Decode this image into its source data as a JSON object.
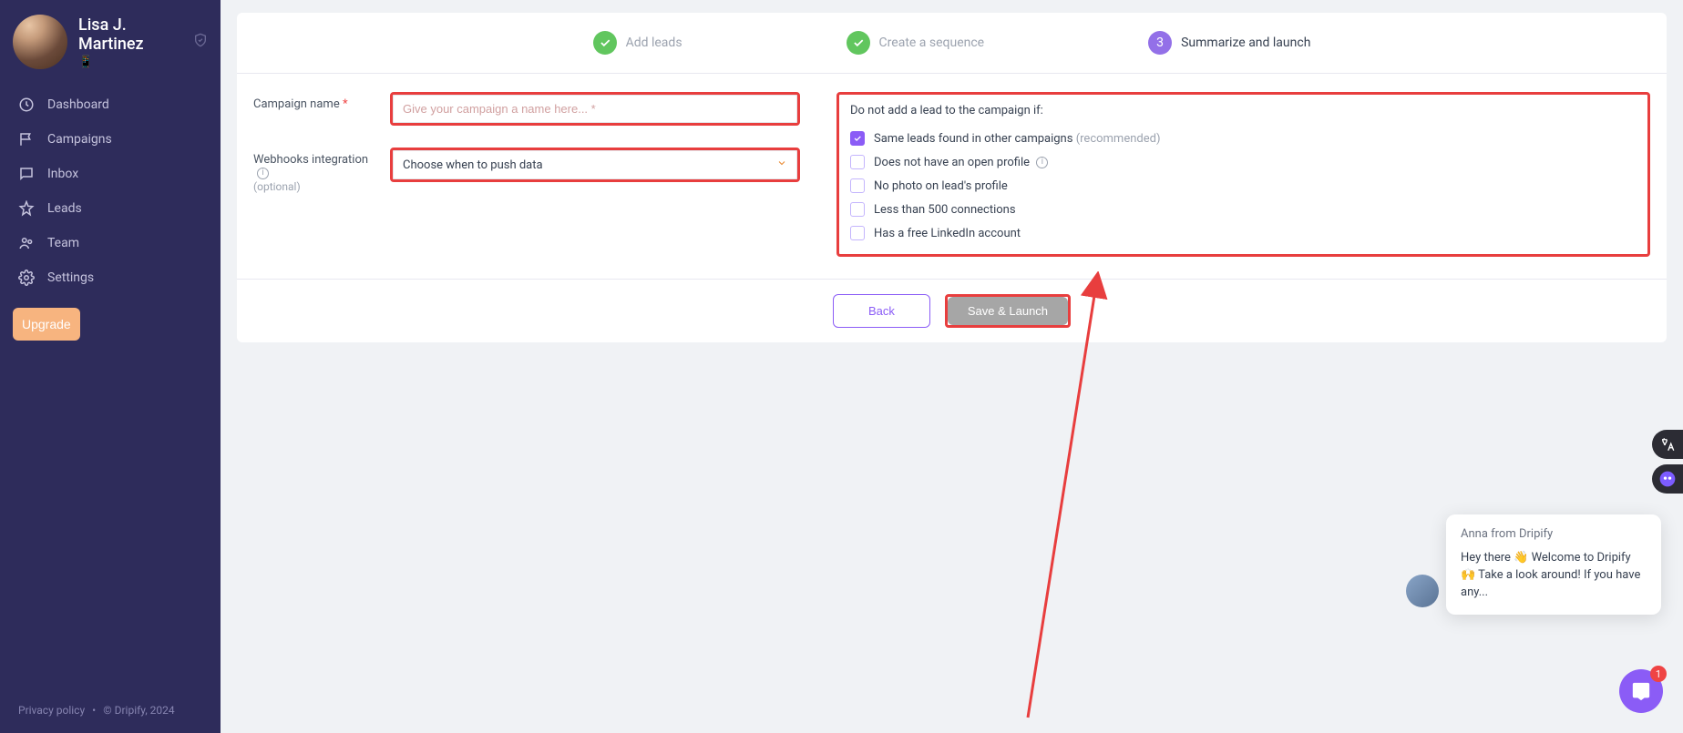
{
  "user": {
    "name": "Lisa J. Martinez",
    "subtitle": "📱"
  },
  "sidebar": {
    "items": [
      {
        "label": "Dashboard"
      },
      {
        "label": "Campaigns"
      },
      {
        "label": "Inbox"
      },
      {
        "label": "Leads"
      },
      {
        "label": "Team"
      },
      {
        "label": "Settings"
      }
    ],
    "upgrade": "Upgrade"
  },
  "footer": {
    "privacy": "Privacy policy",
    "copy": "© Dripify, 2024"
  },
  "stepper": {
    "step1": "Add leads",
    "step2": "Create a sequence",
    "step3": "Summarize and launch",
    "step3_num": "3"
  },
  "form": {
    "campaign_label": "Campaign name",
    "campaign_placeholder": "Give your campaign a name here... *",
    "webhooks_label": "Webhooks integration",
    "webhooks_opt": "(optional)",
    "webhooks_select": "Choose when to push data"
  },
  "filters": {
    "title": "Do not add a lead to the campaign if:",
    "items": [
      {
        "label": "Same leads found in other campaigns",
        "suffix": "(recommended)",
        "checked": true
      },
      {
        "label": "Does not have an open profile",
        "info": true
      },
      {
        "label": "No photo on lead's profile"
      },
      {
        "label": "Less than 500 connections"
      },
      {
        "label": "Has a free LinkedIn account"
      }
    ]
  },
  "actions": {
    "back": "Back",
    "save": "Save & Launch"
  },
  "chat": {
    "from": "Anna from Dripify",
    "msg": "Hey there 👋 Welcome to Dripify 🙌 Take a look around! If you have any...",
    "badge": "1"
  }
}
